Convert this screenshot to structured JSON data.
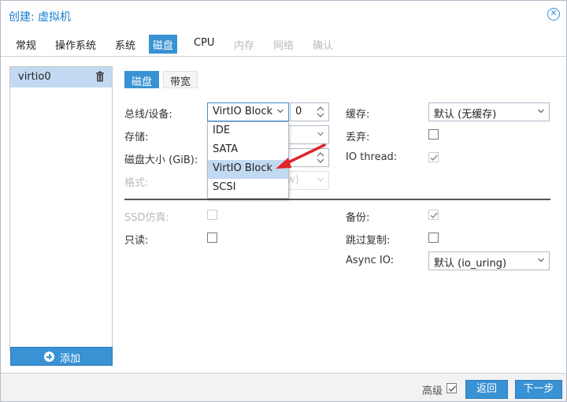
{
  "window": {
    "title": "创建: 虚拟机"
  },
  "tabs": [
    {
      "label": "常规",
      "state": "normal"
    },
    {
      "label": "操作系统",
      "state": "normal"
    },
    {
      "label": "系统",
      "state": "normal"
    },
    {
      "label": "磁盘",
      "state": "active"
    },
    {
      "label": "CPU",
      "state": "normal"
    },
    {
      "label": "内存",
      "state": "disabled"
    },
    {
      "label": "网络",
      "state": "disabled"
    },
    {
      "label": "确认",
      "state": "disabled"
    }
  ],
  "disks": {
    "items": [
      {
        "label": "virtio0"
      }
    ],
    "add_label": "添加"
  },
  "subtabs": {
    "disk": "磁盘",
    "bandwidth": "带宽"
  },
  "form": {
    "bus_label": "总线/设备:",
    "bus_value": "VirtIO Block",
    "device_number": "0",
    "storage_label": "存储:",
    "disk_size_label": "磁盘大小 (GiB):",
    "format_label": "格式:",
    "format_value_fragment": "w)",
    "cache_label": "缓存:",
    "cache_value": "默认 (无缓存)",
    "discard_label": "丢弃:",
    "discard_checked": false,
    "iothread_label": "IO thread:",
    "iothread_checked": true,
    "ssd_label": "SSD仿真:",
    "ssd_checked": false,
    "readonly_label": "只读:",
    "readonly_checked": false,
    "backup_label": "备份:",
    "backup_checked": true,
    "skip_replication_label": "跳过复制:",
    "skip_replication_checked": false,
    "async_io_label": "Async IO:",
    "async_io_value": "默认 (io_uring)"
  },
  "bus_dropdown": {
    "options": [
      "IDE",
      "SATA",
      "VirtIO Block",
      "SCSI"
    ],
    "selected": "VirtIO Block"
  },
  "footer": {
    "advanced_label": "高级",
    "advanced_checked": true,
    "back_label": "返回",
    "next_label": "下一步"
  },
  "colors": {
    "accent": "#3892d4",
    "title": "#157fcc",
    "selection": "#c2daf1",
    "annotation_arrow": "#e0262b"
  },
  "icons": [
    "close-icon",
    "trash-icon",
    "add-icon",
    "chevron-down-icon",
    "spinner-icon",
    "checkmark-icon",
    "annotation-arrow"
  ]
}
